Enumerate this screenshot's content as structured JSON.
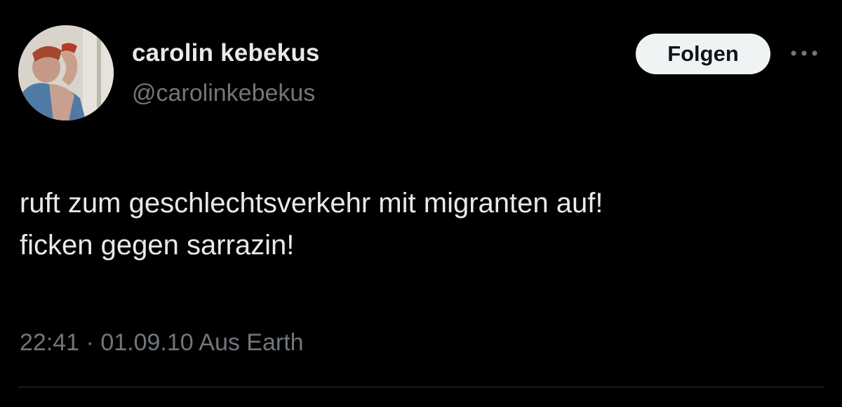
{
  "user": {
    "display_name": "carolin kebekus",
    "handle": "@carolinkebekus"
  },
  "actions": {
    "follow_label": "Folgen",
    "more_icon": "more-horizontal-icon"
  },
  "tweet": {
    "text": "ruft zum geschlechtsverkehr mit migranten auf!\nficken gegen sarrazin!",
    "time": "22:41",
    "separator": "·",
    "date": "01.09.10",
    "source": "Aus Earth"
  },
  "colors": {
    "background": "#000000",
    "text_primary": "#e7e9ea",
    "text_secondary": "#71767b",
    "button_bg": "#eff3f4",
    "divider": "#2f3336"
  }
}
